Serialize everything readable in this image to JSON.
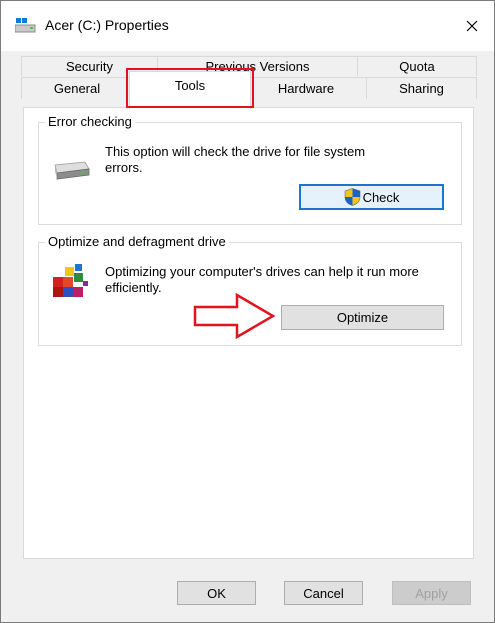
{
  "window": {
    "title": "Acer (C:) Properties"
  },
  "tabs": {
    "row1": [
      "Security",
      "Previous Versions",
      "Quota"
    ],
    "row2": [
      "General",
      "Tools",
      "Hardware",
      "Sharing"
    ],
    "active": "Tools"
  },
  "error_checking": {
    "title": "Error checking",
    "description": "This option will check the drive for file system errors.",
    "button": "Check"
  },
  "optimize": {
    "title": "Optimize and defragment drive",
    "description": "Optimizing your computer's drives can help it run more efficiently.",
    "button": "Optimize"
  },
  "footer": {
    "ok": "OK",
    "cancel": "Cancel",
    "apply": "Apply"
  },
  "colors": {
    "highlight": "#e0141e",
    "accent": "#1f75cc"
  }
}
